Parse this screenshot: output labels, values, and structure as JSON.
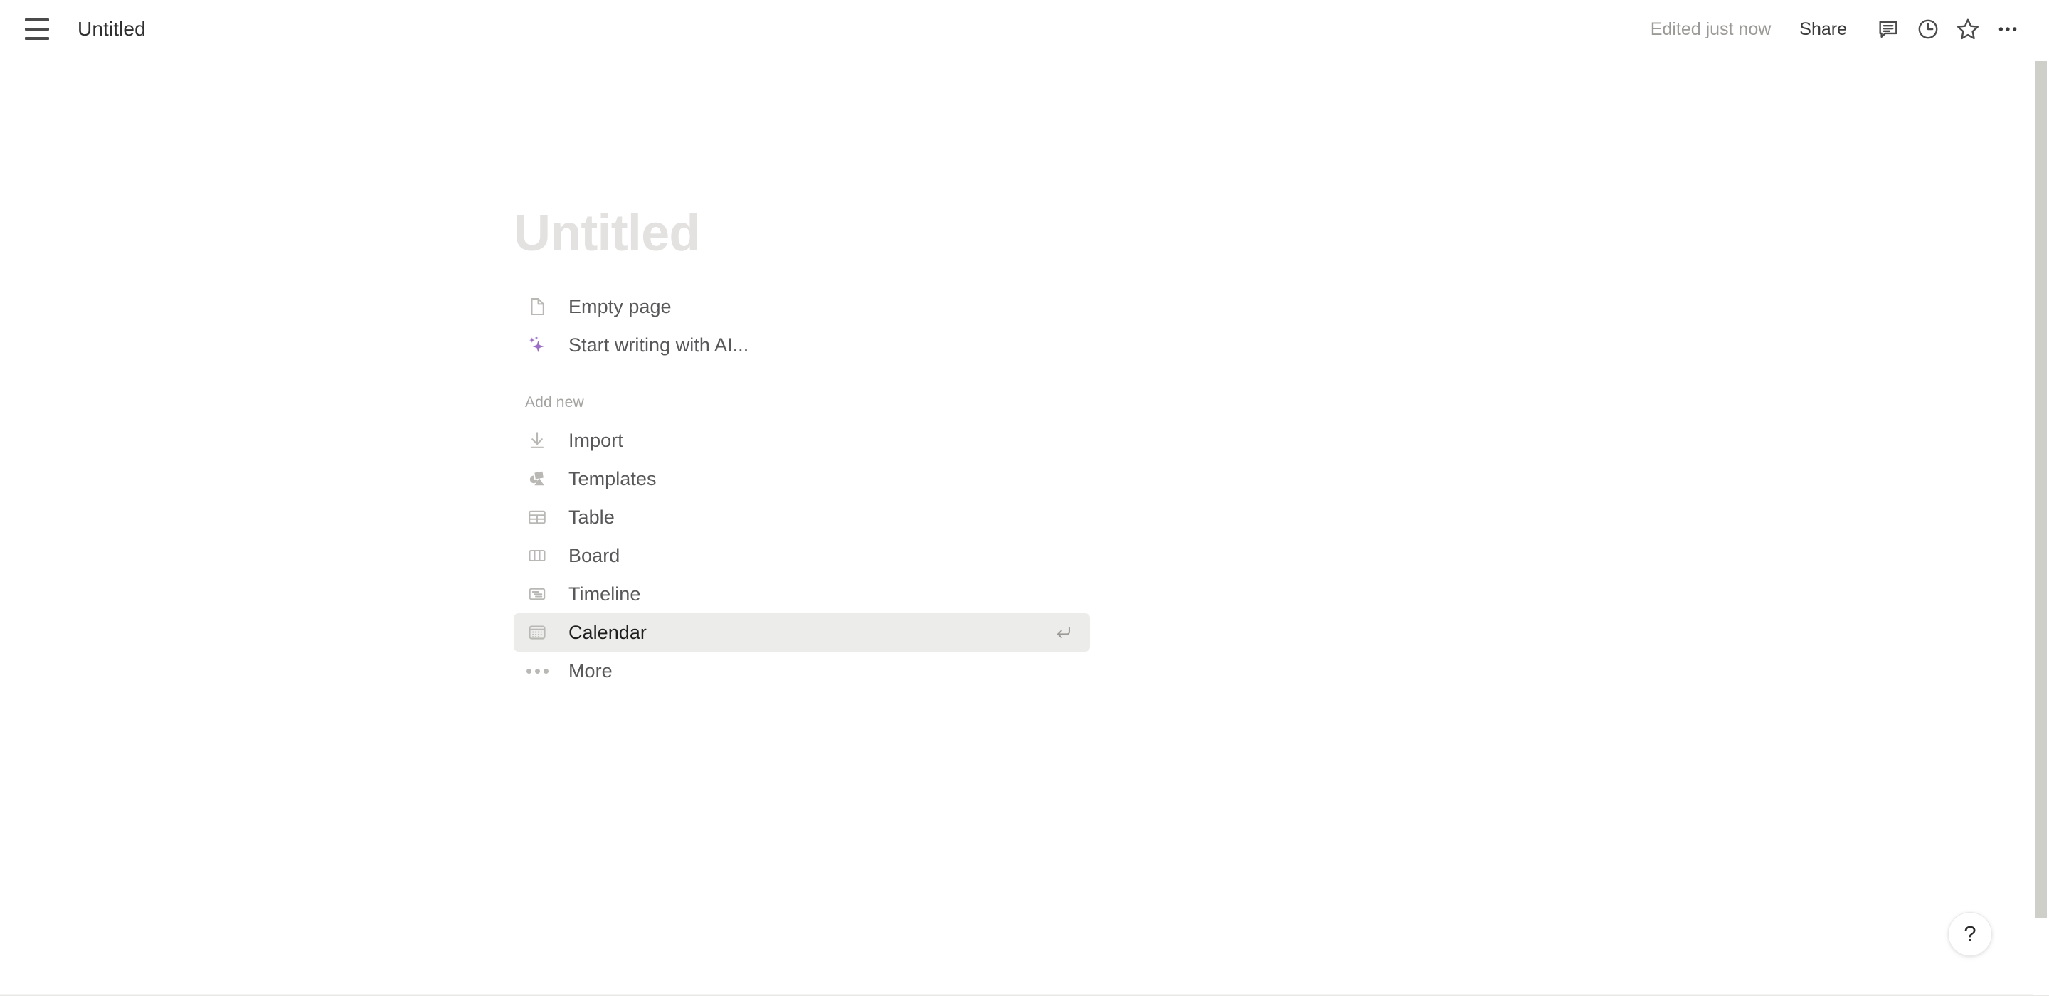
{
  "window": {
    "title": "Untitled"
  },
  "topbar": {
    "menu_icon": "hamburger-menu-icon",
    "doc_title": "Untitled",
    "edited_status": "Edited just now",
    "share_label": "Share",
    "icons": [
      {
        "name": "comment-icon",
        "label": "Comments"
      },
      {
        "name": "clock-history-icon",
        "label": "Page history"
      },
      {
        "name": "star-icon",
        "label": "Add to favorites"
      },
      {
        "name": "more-options-icon",
        "label": "More options"
      }
    ]
  },
  "page": {
    "title_placeholder": "Untitled",
    "primary_options": [
      {
        "icon": "empty-page-icon",
        "label": "Empty page",
        "selected": false
      },
      {
        "icon": "ai-sparkle-icon",
        "label": "Start writing with AI...",
        "selected": false
      }
    ],
    "add_new_label": "Add new",
    "add_new_options": [
      {
        "icon": "import-icon",
        "label": "Import",
        "selected": false
      },
      {
        "icon": "templates-icon",
        "label": "Templates",
        "selected": false
      },
      {
        "icon": "table-icon",
        "label": "Table",
        "selected": false
      },
      {
        "icon": "board-icon",
        "label": "Board",
        "selected": false
      },
      {
        "icon": "timeline-icon",
        "label": "Timeline",
        "selected": false
      },
      {
        "icon": "calendar-icon",
        "label": "Calendar",
        "selected": true,
        "shortcut": "↵"
      },
      {
        "icon": "more-dots-icon",
        "label": "More",
        "selected": false
      }
    ]
  },
  "help": {
    "label": "?"
  },
  "colors": {
    "accent_ai": "#9b6dc4",
    "selected_row_bg": "#ececeb",
    "title_placeholder": "#e3e2e0",
    "text_primary": "#2f2f2f",
    "text_secondary": "#58585a",
    "text_muted": "#9b9a97",
    "icon_gray": "#b9b8b5",
    "scrollbar": "#cfcfca"
  }
}
